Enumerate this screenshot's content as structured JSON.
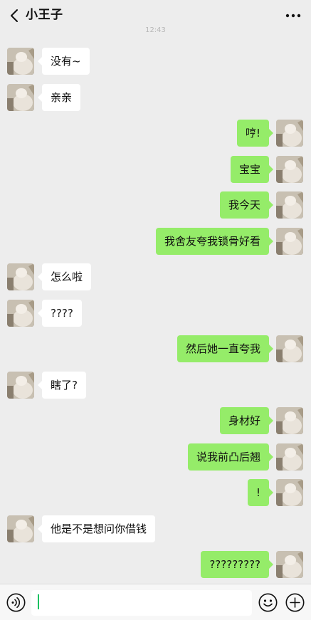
{
  "header": {
    "title": "小王子",
    "back_icon": "chevron-left-icon",
    "more_icon": "more-horizontal-icon"
  },
  "timestamp": "12:43",
  "colors": {
    "background": "#ededed",
    "incoming_bubble": "#ffffff",
    "outgoing_bubble": "#95ec69",
    "input_bar": "#f7f7f7",
    "cursor": "#07c160"
  },
  "messages": [
    {
      "side": "in",
      "text": "没有~"
    },
    {
      "side": "in",
      "text": "亲亲"
    },
    {
      "side": "out",
      "text": "哼!"
    },
    {
      "side": "out",
      "text": "宝宝"
    },
    {
      "side": "out",
      "text": "我今天"
    },
    {
      "side": "out",
      "text": "我舍友夸我锁骨好看"
    },
    {
      "side": "in",
      "text": "怎么啦"
    },
    {
      "side": "in",
      "text": "????"
    },
    {
      "side": "out",
      "text": "然后她一直夸我"
    },
    {
      "side": "in",
      "text": "瞎了?"
    },
    {
      "side": "out",
      "text": "身材好"
    },
    {
      "side": "out",
      "text": "说我前凸后翘"
    },
    {
      "side": "out",
      "text": "!"
    },
    {
      "side": "in",
      "text": "他是不是想问你借钱"
    },
    {
      "side": "out",
      "text": "?????????"
    }
  ],
  "input_bar": {
    "voice_icon": "voice-icon",
    "message_value": "",
    "emoji_icon": "emoji-icon",
    "plus_icon": "plus-circle-icon"
  }
}
